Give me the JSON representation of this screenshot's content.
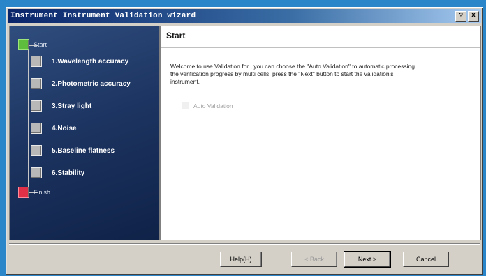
{
  "window": {
    "title": "Instrument Instrument Validation wizard",
    "help_button": "?",
    "close_button": "X"
  },
  "steps": [
    {
      "label": "Start",
      "kind": "start"
    },
    {
      "label": "1.Wavelength accuracy",
      "kind": "step"
    },
    {
      "label": "2.Photometric accuracy",
      "kind": "step"
    },
    {
      "label": "3.Stray light",
      "kind": "step"
    },
    {
      "label": "4.Noise",
      "kind": "step"
    },
    {
      "label": "5.Baseline flatness",
      "kind": "step"
    },
    {
      "label": "6.Stability",
      "kind": "step"
    },
    {
      "label": "Finish",
      "kind": "finish"
    }
  ],
  "content": {
    "title": "Start",
    "welcome_text": "Welcome to use Validation for , you can choose the \"Auto Validation\" to automatic processing the verification progress by multi cells; press the \"Next\" button to start the validation's instrument.",
    "auto_validation_label": "Auto Validation",
    "auto_validation_checked": false
  },
  "buttons": {
    "help": "Help(H)",
    "back": "< Back",
    "next": "Next >",
    "cancel": "Cancel"
  },
  "colors": {
    "start_marker": "#5fbd3e",
    "finish_marker": "#e03048",
    "step_marker": "#b8b8b8"
  }
}
